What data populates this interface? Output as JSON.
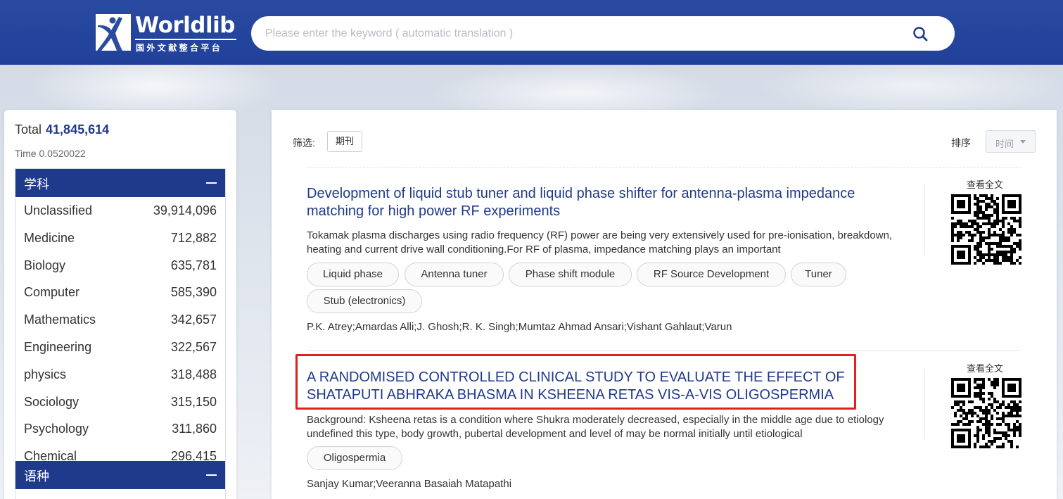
{
  "header": {
    "logo_name": "Worldlib",
    "logo_subtitle": "国外文献整合平台",
    "search_placeholder": "Please enter the keyword ( automatic translation )",
    "search_icon": "search-icon"
  },
  "colors": {
    "header_blue": "#2a4ba0",
    "accent_navy": "#1f3a8a",
    "highlight_red": "#e02020"
  },
  "sidebar": {
    "total_label": "Total",
    "total_value": "41,845,614",
    "time_text": "Time 0.0520022",
    "subject_heading": "学科",
    "subjects": [
      {
        "name": "Unclassified",
        "count": "39,914,096"
      },
      {
        "name": "Medicine",
        "count": "712,882"
      },
      {
        "name": "Biology",
        "count": "635,781"
      },
      {
        "name": "Computer",
        "count": "585,390"
      },
      {
        "name": "Mathematics",
        "count": "342,657"
      },
      {
        "name": "Engineering",
        "count": "322,567"
      },
      {
        "name": "physics",
        "count": "318,488"
      },
      {
        "name": "Sociology",
        "count": "315,150"
      },
      {
        "name": "Psychology",
        "count": "311,860"
      },
      {
        "name": "Chemical",
        "count": "296,415"
      }
    ],
    "language_heading": "语种"
  },
  "toolbar": {
    "filter_label": "筛选:",
    "filter_chip": "期刊",
    "sort_label": "排序",
    "sort_value": "时间"
  },
  "results": [
    {
      "title": "Development of liquid stub tuner and liquid phase shifter for antenna-plasma impedance matching for high power RF experiments",
      "abstract": "Tokamak plasma discharges using radio frequency (RF) power are being very extensively used for pre-ionisation, breakdown, heating and current drive wall conditioning.For RF of plasma, impedance matching plays an important",
      "tags": [
        "Liquid phase",
        "Antenna tuner",
        "Phase shift module",
        "RF Source Development",
        "Tuner",
        "Stub (electronics)"
      ],
      "authors": "P.K. Atrey;Amardas Alli;J. Ghosh;R. K. Singh;Mumtaz Ahmad Ansari;Vishant Gahlaut;Varun",
      "qr_label": "查看全文"
    },
    {
      "title": "A RANDOMISED CONTROLLED CLINICAL STUDY TO EVALUATE THE EFFECT OF SHATAPUTI ABHRAKA BHASMA IN KSHEENA RETAS VIS-A-VIS OLIGOSPERMIA",
      "abstract": "Background: Ksheena retas is a condition where Shukra moderately decreased, especially in the middle age due to etiology undefined this type, body growth, pubertal development and level of may be normal initially until etiological",
      "tags": [
        "Oligospermia"
      ],
      "authors": "Sanjay Kumar;Veeranna Basaiah Matapathi",
      "qr_label": "查看全文"
    }
  ]
}
